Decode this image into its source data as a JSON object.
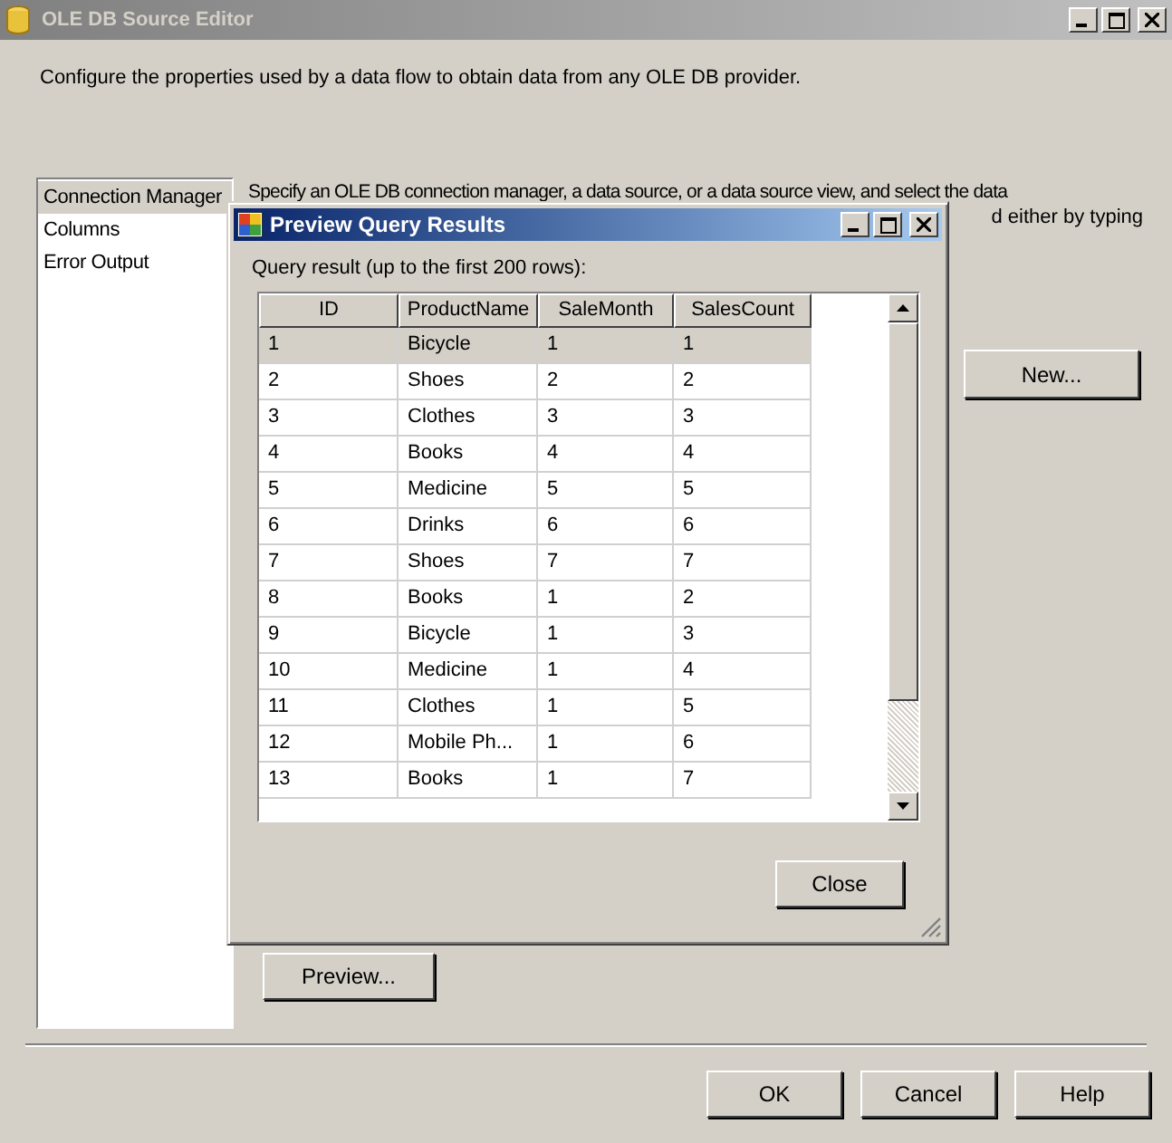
{
  "window": {
    "title": "OLE DB Source Editor",
    "description": "Configure the properties used by a data flow to obtain data from any OLE DB provider."
  },
  "nav": [
    {
      "label": "Connection Manager",
      "selected": true
    },
    {
      "label": "Columns",
      "selected": false
    },
    {
      "label": "Error Output",
      "selected": false
    }
  ],
  "panel": {
    "intro_line_1": "Specify an OLE DB connection manager, a data source, or a data source view, and select the data",
    "intro_line_2": "d either by typing",
    "new_button": "New...",
    "preview_button": "Preview..."
  },
  "dialog": {
    "title": "Preview Query Results",
    "caption": "Query result (up to the first 200 rows):",
    "columns": [
      "ID",
      "ProductName",
      "SaleMonth",
      "SalesCount"
    ],
    "rows": [
      {
        "cells": [
          "1",
          "Bicycle",
          "1",
          "1"
        ],
        "selected": true
      },
      {
        "cells": [
          "2",
          "Shoes",
          "2",
          "2"
        ],
        "selected": false
      },
      {
        "cells": [
          "3",
          "Clothes",
          "3",
          "3"
        ],
        "selected": false
      },
      {
        "cells": [
          "4",
          "Books",
          "4",
          "4"
        ],
        "selected": false
      },
      {
        "cells": [
          "5",
          "Medicine",
          "5",
          "5"
        ],
        "selected": false
      },
      {
        "cells": [
          "6",
          "Drinks",
          "6",
          "6"
        ],
        "selected": false
      },
      {
        "cells": [
          "7",
          "Shoes",
          "7",
          "7"
        ],
        "selected": false
      },
      {
        "cells": [
          "8",
          "Books",
          "1",
          "2"
        ],
        "selected": false
      },
      {
        "cells": [
          "9",
          "Bicycle",
          "1",
          "3"
        ],
        "selected": false
      },
      {
        "cells": [
          "10",
          "Medicine",
          "1",
          "4"
        ],
        "selected": false
      },
      {
        "cells": [
          "11",
          "Clothes",
          "1",
          "5"
        ],
        "selected": false
      },
      {
        "cells": [
          "12",
          "Mobile Ph...",
          "1",
          "6"
        ],
        "selected": false
      },
      {
        "cells": [
          "13",
          "Books",
          "1",
          "7"
        ],
        "selected": false
      }
    ],
    "close_button": "Close"
  },
  "buttons": [
    "OK",
    "Cancel",
    "Help"
  ]
}
